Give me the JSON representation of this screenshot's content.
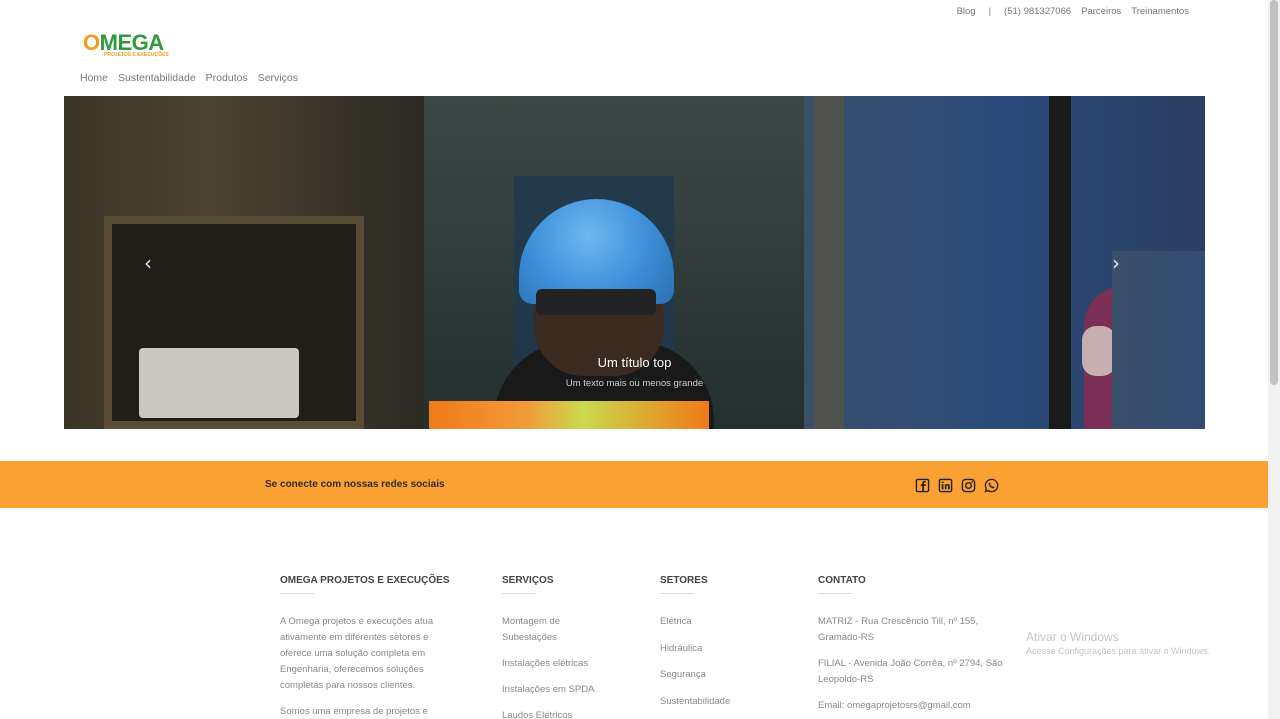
{
  "topbar": {
    "blog": "Blog",
    "separator": "|",
    "phone": "(51) 981327066",
    "parceiros": "Parceiros",
    "treinamentos": "Treinamentos"
  },
  "logo": {
    "name_o": "O",
    "name_rest": "MEGA",
    "tagline": "PROJETOS E EXECUÇÕES"
  },
  "nav": {
    "items": [
      "Home",
      "Sustentabilidade",
      "Produtos",
      "Serviços"
    ]
  },
  "hero": {
    "prev_icon": "chevron-left-icon",
    "next_icon": "chevron-right-icon",
    "caption_title": "Um título top",
    "caption_text": "Um texto mais ou menos grande"
  },
  "social": {
    "label": "Se conecte com nossas redes sociais",
    "icons": [
      "facebook-icon",
      "linkedin-icon",
      "instagram-icon",
      "whatsapp-icon"
    ],
    "band_color": "#fba032"
  },
  "footer": {
    "about": {
      "title": "OMEGA PROJETOS E EXECUÇÕES",
      "p1": "A Omega projetos e execuções atua ativamente em diferentes setores e oferece uma solução completa em Engenharia, oferecemos soluções completas para nossos clientes.",
      "p2": "Somos uma empresa de projetos e"
    },
    "servicos": {
      "title": "SERVIÇOS",
      "items": [
        "Montagem de Subestações",
        "Instalações elétricas",
        "Instalações em SPDA",
        "Laudos Elétricos"
      ]
    },
    "setores": {
      "title": "SETORES",
      "items": [
        "Elétrica",
        "Hidráulica",
        "Segurança",
        "Sustentabilidade"
      ]
    },
    "contato": {
      "title": "CONTATO",
      "matriz": "MATRIZ - Rua Crescêncio Till, nº 155, Gramado-RS",
      "filial": "FILIAL - Avenida João Corrêa, nº 2794, São Leopoldo-RS",
      "email": "Email: omegaprojetosrs@gmail.com"
    }
  },
  "windows_watermark": {
    "title": "Ativar o Windows",
    "subtitle": "Acesse Configurações para ativar o Windows."
  }
}
